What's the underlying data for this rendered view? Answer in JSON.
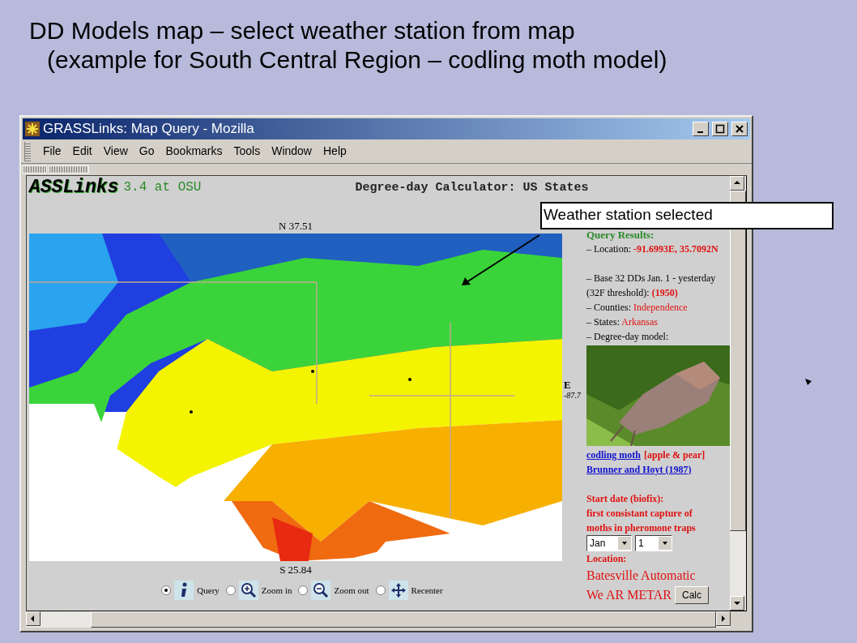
{
  "slide": {
    "title_lines": [
      "DD Models map – select weather station from map",
      "(example for South Central Region – codling moth model)"
    ]
  },
  "window": {
    "title": "GRASSLinks: Map Query - Mozilla"
  },
  "menu": [
    "File",
    "Edit",
    "View",
    "Go",
    "Bookmarks",
    "Tools",
    "Window",
    "Help"
  ],
  "header": {
    "logo": "ASSLinks",
    "version": "3.4 at OSU",
    "heading": "Degree-day Calculator: US States"
  },
  "map": {
    "north": "N 37.51",
    "south": "S 25.84",
    "east": "E",
    "east_value": "-87.7"
  },
  "tools": [
    {
      "kind": "info",
      "label": "Query",
      "selected": true
    },
    {
      "kind": "zoom-in",
      "label": "Zoom in",
      "selected": false
    },
    {
      "kind": "zoom-out",
      "label": "Zoom out",
      "selected": false
    },
    {
      "kind": "pan",
      "label": "Recenter",
      "selected": false
    }
  ],
  "results": {
    "heading": "Query Results:",
    "line_groups": [
      [
        {
          "label": "– Location: ",
          "value": "-91.6993E, 35.7092N",
          "bold": true
        }
      ],
      [
        {
          "label": "– Base 32 DDs Jan. 1 - yesterday (32F threshold): ",
          "value": "(1950)",
          "bold": true
        },
        {
          "label": "– Counties: ",
          "value": "Independence",
          "bold": false
        },
        {
          "label": "– States: ",
          "value": "Arkansas",
          "bold": false
        },
        {
          "label": "– Degree-day model:"
        }
      ]
    ],
    "model": {
      "name": "codling moth",
      "hosts": "[apple & pear]",
      "reference": "Brunner and Hoyt (1987)"
    },
    "start_date": {
      "lines": [
        "Start date (biofix):",
        "first consistant capture of",
        "moths in pheromone traps"
      ],
      "month": "Jan",
      "day": "1"
    },
    "location": {
      "label": "Location:",
      "station_lines": [
        "Batesville Automatic",
        "We AR METAR"
      ],
      "button": "Calc"
    }
  },
  "callout": "Weather station selected"
}
